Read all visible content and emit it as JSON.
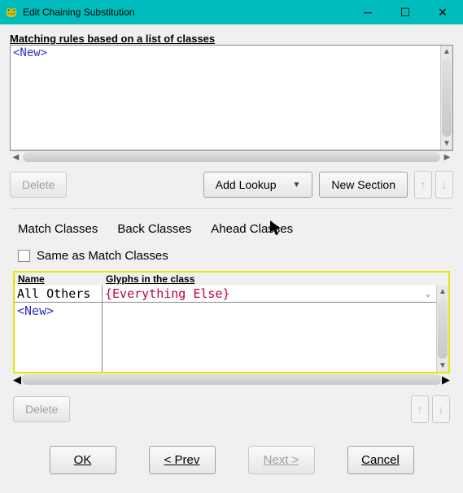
{
  "titlebar": {
    "app_icon": "🐸",
    "title": "Edit Chaining Substitution"
  },
  "rules": {
    "header": "Matching rules based on a list of classes",
    "new_token": "<New>"
  },
  "toolbar1": {
    "delete": "Delete",
    "add_lookup": "Add Lookup",
    "new_section": "New Section"
  },
  "tabs": {
    "match": "Match Classes",
    "back": "Back Classes",
    "ahead": "Ahead Classes"
  },
  "checkbox": {
    "label": "Same as Match Classes"
  },
  "class_table": {
    "col_name": "Name",
    "col_glyphs": "Glyphs in the class",
    "rows": [
      {
        "name": "All Others",
        "glyphs": "{Everything Else}"
      }
    ],
    "new_token": "<New>"
  },
  "toolbar2": {
    "delete": "Delete"
  },
  "footer": {
    "ok": "OK",
    "prev": "< Prev",
    "next": "Next >",
    "cancel": "Cancel"
  }
}
